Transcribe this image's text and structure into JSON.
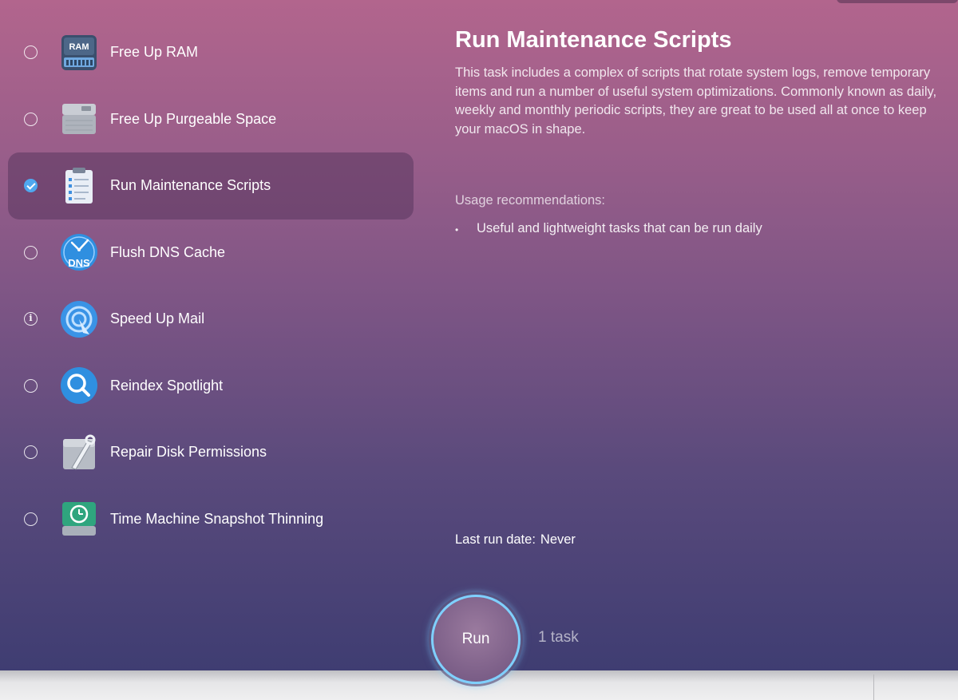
{
  "tasks": [
    {
      "label": "Free Up RAM",
      "state": "unchecked",
      "icon": "ram-chip-icon",
      "icon_text": "RAM"
    },
    {
      "label": "Free Up Purgeable Space",
      "state": "unchecked",
      "icon": "disk-drive-icon"
    },
    {
      "label": "Run Maintenance Scripts",
      "state": "checked",
      "icon": "clipboard-checklist-icon",
      "selected": true
    },
    {
      "label": "Flush DNS Cache",
      "state": "unchecked",
      "icon": "dns-clock-icon",
      "icon_text": "DNS"
    },
    {
      "label": "Speed Up Mail",
      "state": "info",
      "icon": "mail-stamp-icon",
      "info_glyph": "i"
    },
    {
      "label": "Reindex Spotlight",
      "state": "unchecked",
      "icon": "spotlight-search-icon"
    },
    {
      "label": "Repair Disk Permissions",
      "state": "unchecked",
      "icon": "disk-wrench-icon"
    },
    {
      "label": "Time Machine Snapshot Thinning",
      "state": "unchecked",
      "icon": "time-machine-icon"
    }
  ],
  "detail": {
    "title": "Run Maintenance Scripts",
    "description": "This task includes a complex of scripts that rotate system logs, remove temporary items and run a number of useful system optimizations. Commonly known as daily, weekly and monthly periodic scripts, they are great to be used all at once to keep your macOS in shape.",
    "usage_heading": "Usage recommendations:",
    "usage_items": [
      "Useful and lightweight tasks that can be run daily"
    ],
    "bullet": "•",
    "last_run_label": "Last run date:",
    "last_run_value": "Never"
  },
  "footer": {
    "run_label": "Run",
    "task_count": "1 task"
  },
  "colors": {
    "accent": "#4fa8ef",
    "run_ring": "#7fd0ff",
    "selected_row": "#5a375f"
  }
}
